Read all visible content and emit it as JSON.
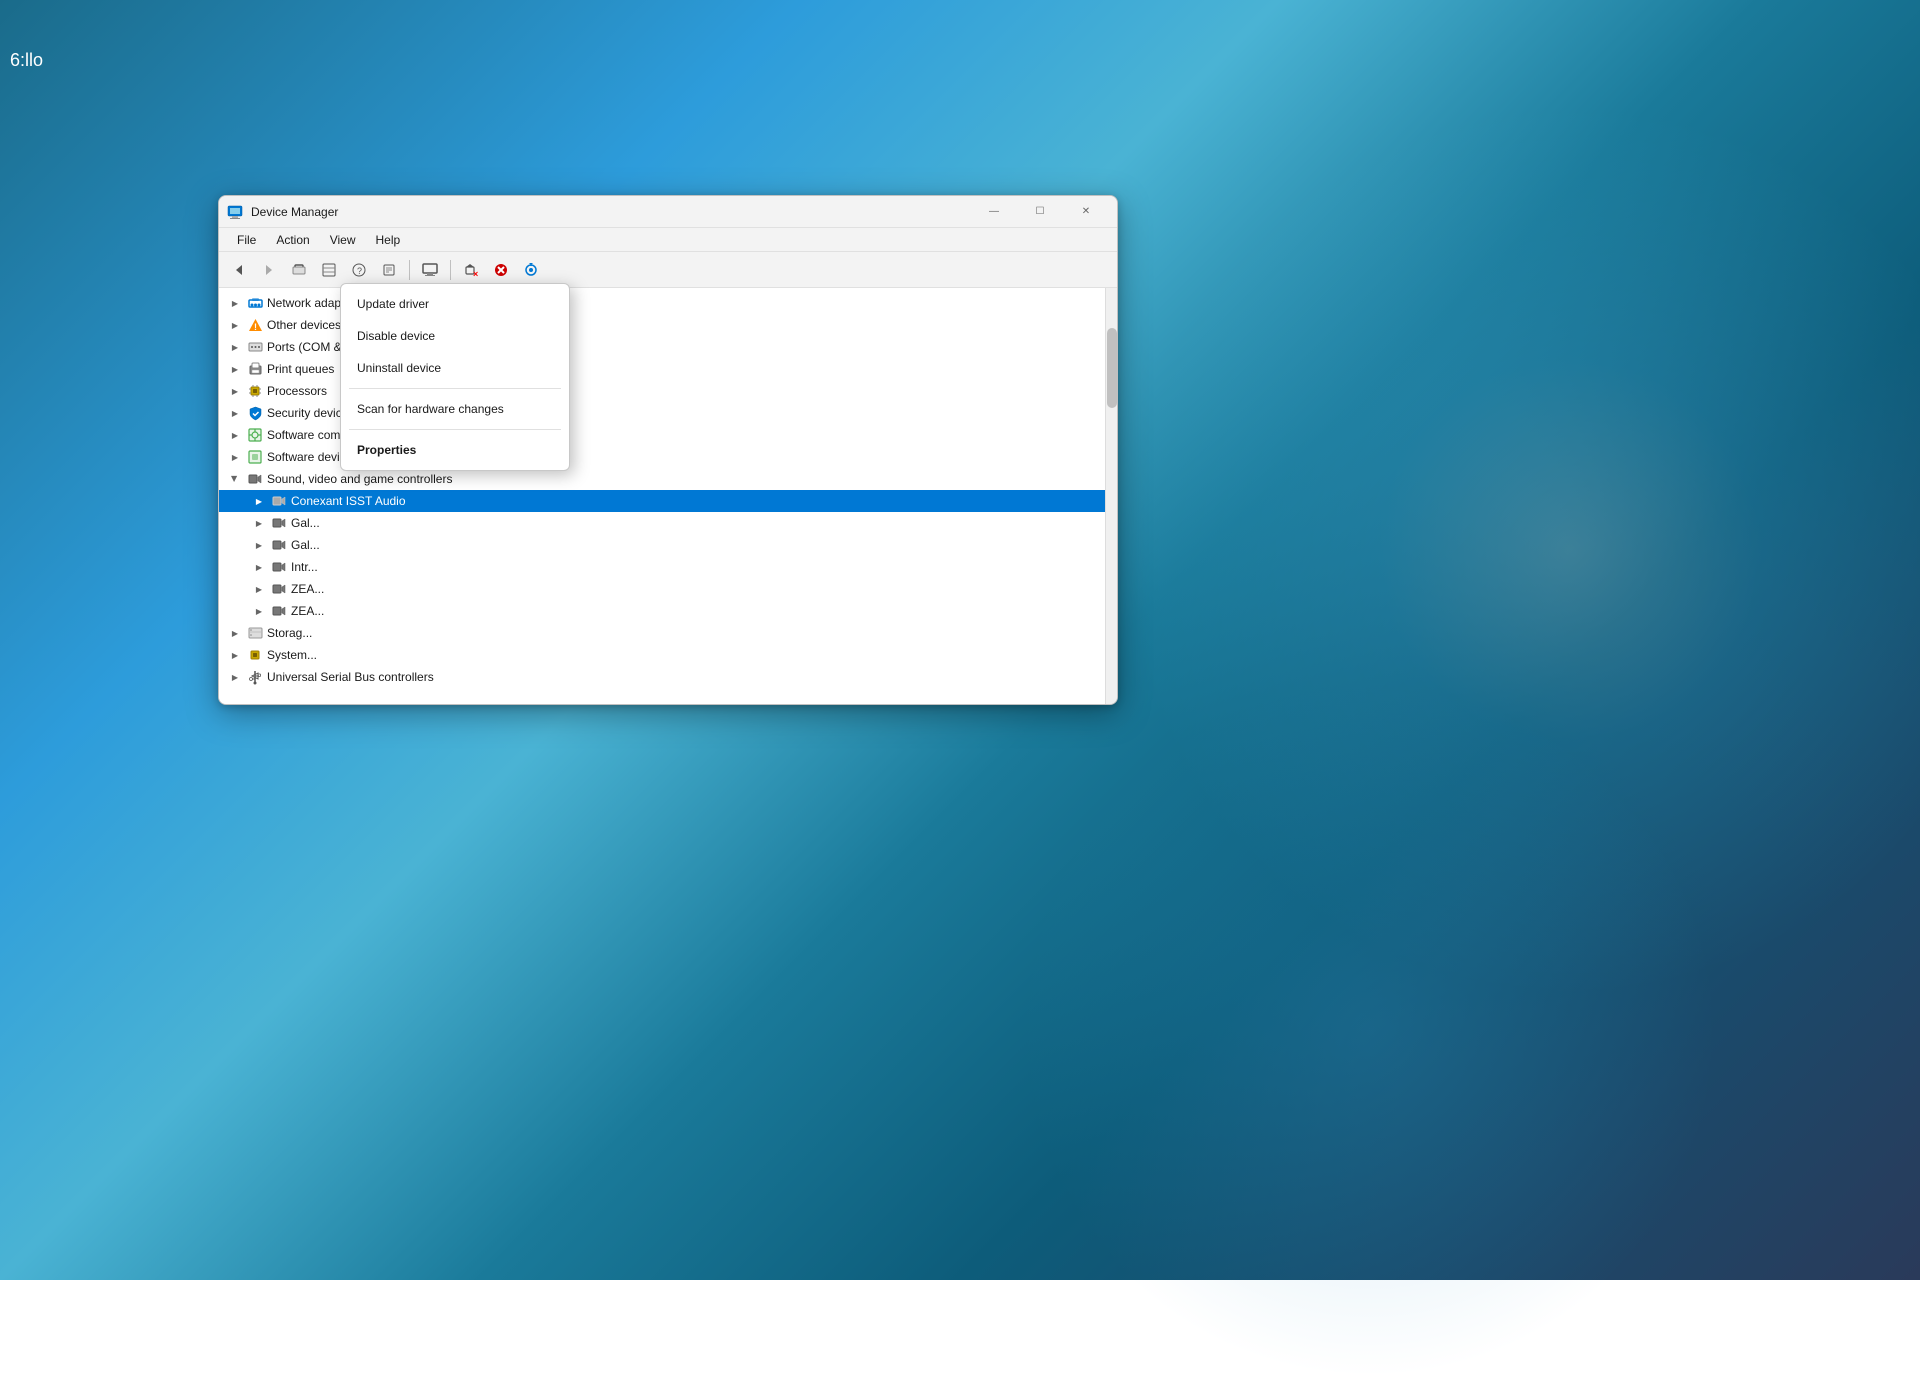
{
  "desktop": {
    "clock": "6:llo"
  },
  "window": {
    "title": "Device Manager",
    "controls": {
      "minimize": "—",
      "maximize": "☐",
      "close": "✕"
    }
  },
  "menu": {
    "items": [
      "File",
      "Action",
      "View",
      "Help"
    ]
  },
  "tree": {
    "items": [
      {
        "id": "network-adapters",
        "label": "Network adapters",
        "level": 0,
        "expanded": false,
        "icon": "network"
      },
      {
        "id": "other-devices",
        "label": "Other devices",
        "level": 0,
        "expanded": false,
        "icon": "warning"
      },
      {
        "id": "ports-com-lpt",
        "label": "Ports (COM & LPT)",
        "level": 0,
        "expanded": false,
        "icon": "ports"
      },
      {
        "id": "print-queues",
        "label": "Print queues",
        "level": 0,
        "expanded": false,
        "icon": "printer"
      },
      {
        "id": "processors",
        "label": "Processors",
        "level": 0,
        "expanded": false,
        "icon": "chip"
      },
      {
        "id": "security-devices",
        "label": "Security devices",
        "level": 0,
        "expanded": false,
        "icon": "shield"
      },
      {
        "id": "software-components",
        "label": "Software components",
        "level": 0,
        "expanded": false,
        "icon": "gear"
      },
      {
        "id": "software-devices",
        "label": "Software devices",
        "level": 0,
        "expanded": false,
        "icon": "gear"
      },
      {
        "id": "sound-video-game",
        "label": "Sound, video and game controllers",
        "level": 0,
        "expanded": true,
        "icon": "audio"
      },
      {
        "id": "conexant-isst",
        "label": "Conexant ISST Audio",
        "level": 1,
        "expanded": false,
        "icon": "audio",
        "selected": true
      },
      {
        "id": "gal-1",
        "label": "Gal...",
        "level": 1,
        "expanded": false,
        "icon": "audio"
      },
      {
        "id": "gal-2",
        "label": "Gal...",
        "level": 1,
        "expanded": false,
        "icon": "audio"
      },
      {
        "id": "intel-audio",
        "label": "Intr...",
        "level": 1,
        "expanded": false,
        "icon": "audio"
      },
      {
        "id": "zea-1",
        "label": "ZEA...",
        "level": 1,
        "expanded": false,
        "icon": "audio"
      },
      {
        "id": "zea-2",
        "label": "ZEA...",
        "level": 1,
        "expanded": false,
        "icon": "audio"
      },
      {
        "id": "storage",
        "label": "Storag...",
        "level": 0,
        "expanded": false,
        "icon": "storage"
      },
      {
        "id": "system",
        "label": "System...",
        "level": 0,
        "expanded": false,
        "icon": "chip"
      },
      {
        "id": "usb-controllers",
        "label": "Universal Serial Bus controllers",
        "level": 0,
        "expanded": false,
        "icon": "usb"
      }
    ]
  },
  "context_menu": {
    "items": [
      {
        "id": "update-driver",
        "label": "Update driver",
        "bold": false,
        "separator_after": false
      },
      {
        "id": "disable-device",
        "label": "Disable device",
        "bold": false,
        "separator_after": false
      },
      {
        "id": "uninstall-device",
        "label": "Uninstall device",
        "bold": false,
        "separator_after": true
      },
      {
        "id": "scan-hardware",
        "label": "Scan for hardware changes",
        "bold": false,
        "separator_after": true
      },
      {
        "id": "properties",
        "label": "Properties",
        "bold": true,
        "separator_after": false
      }
    ]
  }
}
